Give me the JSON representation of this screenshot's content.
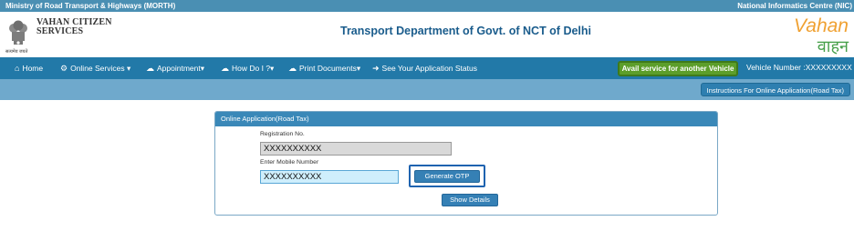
{
  "topstrip": {
    "left": "Ministry of Road Transport & Highways (MORTH)",
    "right": "National Informatics Centre (NIC)"
  },
  "header": {
    "brand_line1": "VAHAN CITIZEN",
    "brand_line2": "SERVICES",
    "emblem_caption": "सत्यमेव जयते",
    "department": "Transport Department of Govt. of NCT of Delhi",
    "logo_en": "Vahan",
    "logo_hi": "वाहन"
  },
  "nav": {
    "home": "Home",
    "online_services": "Online Services",
    "appointment": "Appointment",
    "how_do_i": "How Do I ?",
    "print_documents": "Print Documents",
    "app_status": "See Your Application Status",
    "avail_service": "Avail service for another Vehicle",
    "vehicle_number": "Vehicle Number :XXXXXXXXX"
  },
  "subbar": {
    "instructions": "Instructions For Online Application(Road Tax)"
  },
  "form": {
    "title": "Online Application(Road Tax)",
    "registration_label": "Registration No.",
    "registration_value": "XXXXXXXXXX",
    "mobile_label": "Enter Mobile Number",
    "mobile_value": "XXXXXXXXXX",
    "generate_otp": "Generate OTP",
    "show_details": "Show Details"
  },
  "colors": {
    "nav": "#2279a8",
    "subbar": "#6fa9cc",
    "avail": "#5c9e2a",
    "accent": "#1a5c8c"
  }
}
